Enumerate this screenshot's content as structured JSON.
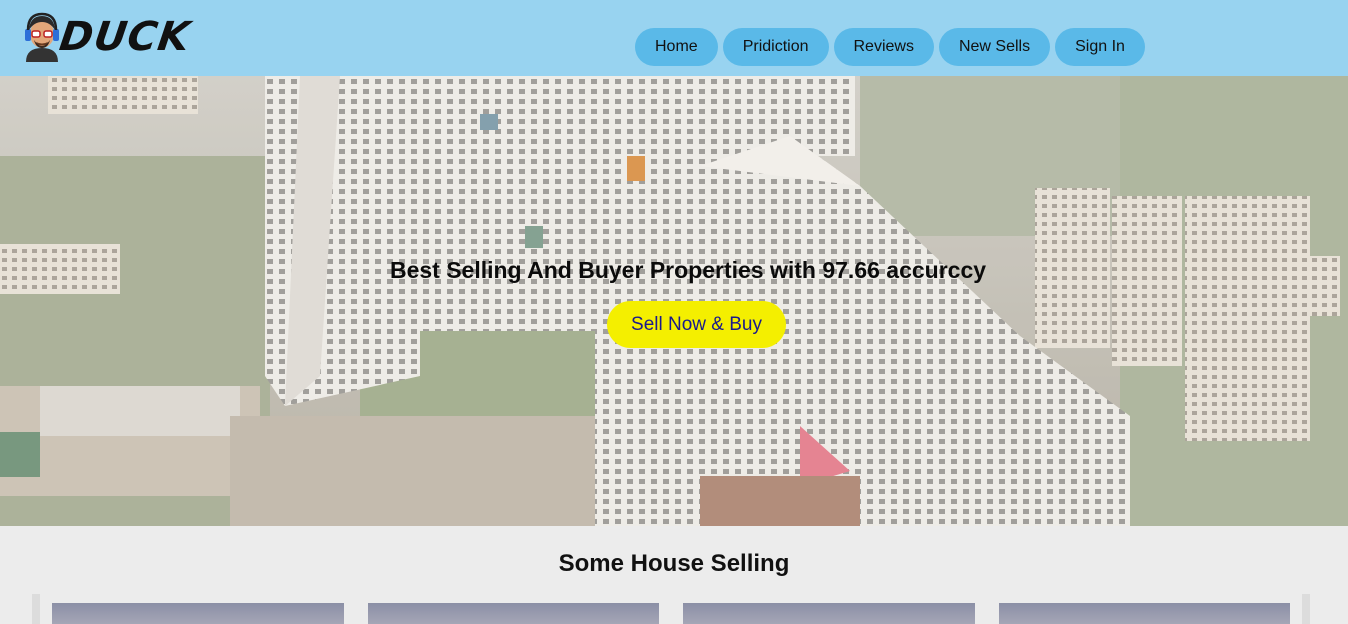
{
  "brand": {
    "name": "DUCK",
    "logo_icon": "cartoon-avatar-with-headphones"
  },
  "nav": {
    "items": [
      {
        "label": "Home"
      },
      {
        "label": "Pridiction"
      },
      {
        "label": "Reviews"
      },
      {
        "label": "New Sells"
      },
      {
        "label": "Sign In"
      }
    ]
  },
  "hero": {
    "title": "Best Selling And Buyer Properties with 97.66 accurccy",
    "cta_label": "Sell Now & Buy"
  },
  "section": {
    "title": "Some House Selling",
    "card_count_visible": 4
  },
  "colors": {
    "header_bg": "#98d3f0",
    "nav_pill": "#5ab9e8",
    "cta_bg": "#f4ef00",
    "cta_text": "#1a1a8c",
    "page_bg": "#ececec"
  }
}
